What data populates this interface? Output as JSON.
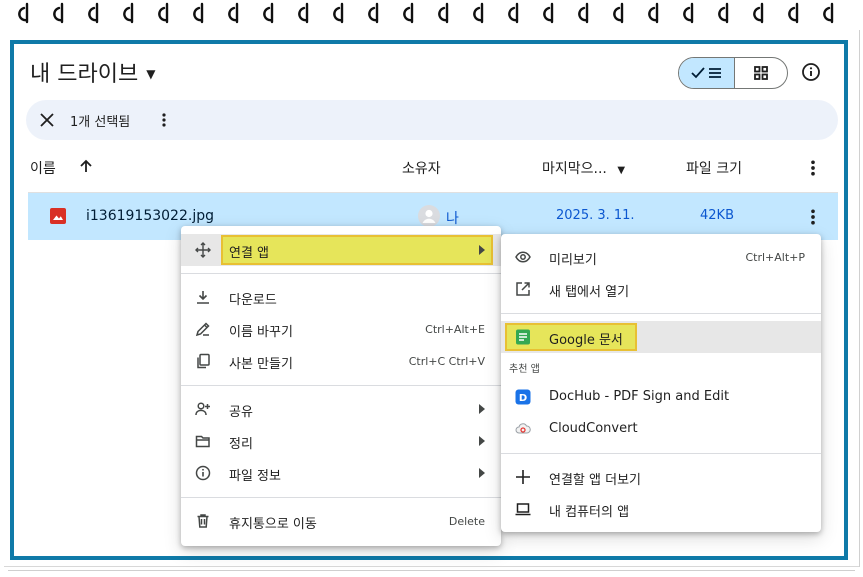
{
  "header": {
    "title": "내 드라이브"
  },
  "selection": {
    "count_label": "1개 선택됨"
  },
  "columns": {
    "name": "이름",
    "owner": "소유자",
    "modified": "마지막으...",
    "size": "파일 크기"
  },
  "file": {
    "name": "i13619153022.jpg",
    "owner": "나",
    "modified": "2025. 3. 11.",
    "size": "42KB"
  },
  "context_menu": {
    "open_with": "연결 앱",
    "download": "다운로드",
    "rename": "이름 바꾸기",
    "rename_shortcut": "Ctrl+Alt+E",
    "copy": "사본 만들기",
    "copy_shortcut": "Ctrl+C Ctrl+V",
    "share": "공유",
    "organize": "정리",
    "file_info": "파일 정보",
    "trash": "휴지통으로 이동",
    "trash_shortcut": "Delete"
  },
  "open_with_menu": {
    "preview": "미리보기",
    "preview_shortcut": "Ctrl+Alt+P",
    "new_tab": "새 탭에서 열기",
    "google_docs": "Google 문서",
    "suggested_header": "추천 앱",
    "dochub": "DocHub - PDF Sign and Edit",
    "cloudconvert": "CloudConvert",
    "more_apps": "연결할 앱 더보기",
    "computer_apps": "내 컴퓨터의 앱"
  },
  "colors": {
    "frame": "#0f7aa8",
    "selected_row": "#c2e7ff",
    "highlight": "#e6e55a",
    "link_blue": "#0b57d0"
  }
}
